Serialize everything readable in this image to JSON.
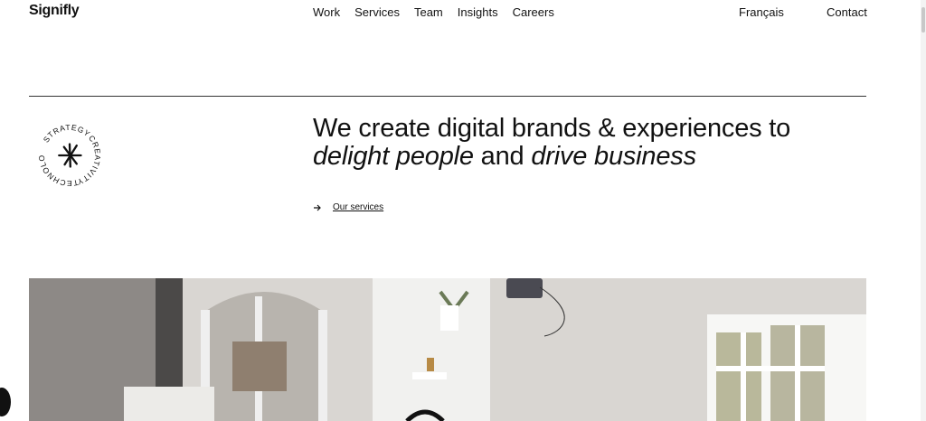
{
  "nav": {
    "logo": "Signifly",
    "links": [
      "Work",
      "Services",
      "Team",
      "Insights",
      "Careers"
    ],
    "language": "Français",
    "contact": "Contact"
  },
  "badge": {
    "words": [
      "STRATEGY",
      "CREATIVITY",
      "TECHNOLOGY"
    ]
  },
  "hero": {
    "line1": "We create digital brands & experiences to",
    "italic1": "delight people",
    "and": " and ",
    "italic2": "drive business",
    "cta_label": "Our services"
  },
  "colors": {
    "text": "#111111",
    "background": "#ffffff",
    "rule": "#333333"
  }
}
